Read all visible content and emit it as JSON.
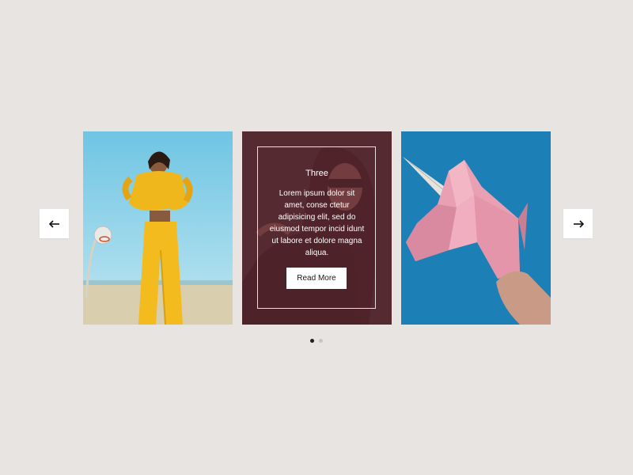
{
  "carousel": {
    "prev_arrow": "←",
    "next_arrow": "→",
    "cards": [
      {
        "image": "woman-in-yellow-tracksuit",
        "accent": "#f2c21b"
      },
      {
        "image": "woman-with-sunglasses",
        "title": "Three",
        "text": "Lorem ipsum dolor sit amet, conse ctetur adipisicing elit, sed do eiusmod tempor incid idunt ut labore et dolore magna aliqua.",
        "button_label": "Read More",
        "overlay_color": "#5f2830"
      },
      {
        "image": "pink-paper-unicorn",
        "accent": "#1c7fb5"
      }
    ],
    "pagination": {
      "count": 2,
      "active": 1
    }
  }
}
